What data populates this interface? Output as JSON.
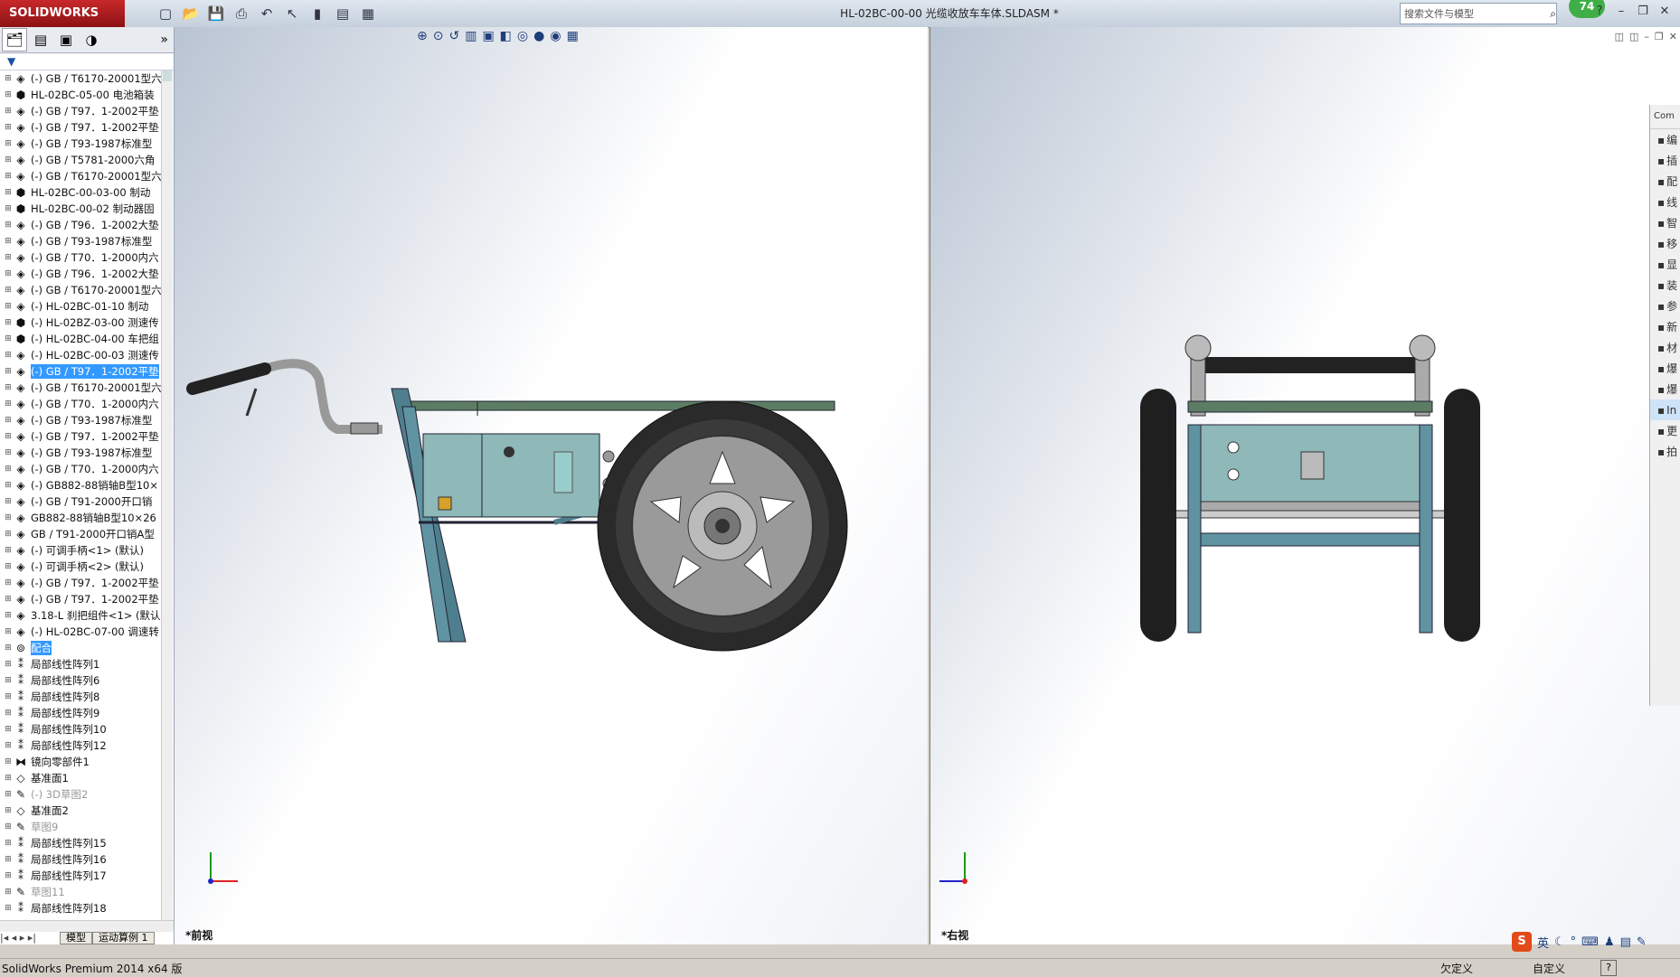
{
  "app": {
    "brand": "SOLIDWORKS",
    "doc_title": "HL-02BC-00-00 光缆收放车车体.SLDASM *",
    "badge": "74"
  },
  "search": {
    "placeholder": "搜索文件与模型"
  },
  "tree": [
    {
      "label": "(-) GB / T6170-20001型六",
      "icon": "part-icon"
    },
    {
      "label": "HL-02BC-05-00 电池箱装",
      "icon": "assembly-icon"
    },
    {
      "label": "(-) GB / T97．1-2002平垫",
      "icon": "part-icon"
    },
    {
      "label": "(-) GB / T97．1-2002平垫",
      "icon": "part-icon"
    },
    {
      "label": "(-) GB / T93-1987标准型",
      "icon": "part-icon"
    },
    {
      "label": "(-) GB / T5781-2000六角",
      "icon": "part-icon"
    },
    {
      "label": "(-) GB / T6170-20001型六",
      "icon": "part-icon"
    },
    {
      "label": "HL-02BC-00-03-00 制动",
      "icon": "assembly-icon"
    },
    {
      "label": "HL-02BC-00-02 制动器固",
      "icon": "assembly-icon"
    },
    {
      "label": "(-) GB / T96．1-2002大垫",
      "icon": "part-icon"
    },
    {
      "label": "(-) GB / T93-1987标准型",
      "icon": "part-icon"
    },
    {
      "label": "(-) GB / T70．1-2000内六",
      "icon": "part-icon"
    },
    {
      "label": "(-) GB / T96．1-2002大垫",
      "icon": "part-icon"
    },
    {
      "label": "(-) GB / T6170-20001型六",
      "icon": "part-icon"
    },
    {
      "label": "(-) HL-02BC-01-10 制动",
      "icon": "part-icon"
    },
    {
      "label": "(-) HL-02BZ-03-00 测速传",
      "icon": "assembly-icon"
    },
    {
      "label": "(-) HL-02BC-04-00 车把组",
      "icon": "assembly-icon"
    },
    {
      "label": "(-) HL-02BC-00-03 测速传",
      "icon": "part-icon"
    },
    {
      "label": "(-) GB / T97．1-2002平垫",
      "icon": "part-icon",
      "selected": true
    },
    {
      "label": "(-) GB / T6170-20001型六",
      "icon": "part-icon"
    },
    {
      "label": "(-) GB / T70．1-2000内六",
      "icon": "part-icon"
    },
    {
      "label": "(-) GB / T93-1987标准型",
      "icon": "part-icon"
    },
    {
      "label": "(-) GB / T97．1-2002平垫",
      "icon": "part-icon"
    },
    {
      "label": "(-) GB / T93-1987标准型",
      "icon": "part-icon"
    },
    {
      "label": "(-) GB / T70．1-2000内六",
      "icon": "part-icon"
    },
    {
      "label": "(-) GB882-88销轴B型10×",
      "icon": "part-icon"
    },
    {
      "label": "(-) GB / T91-2000开口销",
      "icon": "part-icon"
    },
    {
      "label": "GB882-88销轴B型10×26",
      "icon": "part-icon"
    },
    {
      "label": "GB / T91-2000开口销A型",
      "icon": "part-icon"
    },
    {
      "label": "(-) 可调手柄<1> (默认)",
      "icon": "part-icon"
    },
    {
      "label": "(-) 可调手柄<2> (默认)",
      "icon": "part-icon"
    },
    {
      "label": "(-) GB / T97．1-2002平垫",
      "icon": "part-icon"
    },
    {
      "label": "(-) GB / T97．1-2002平垫",
      "icon": "part-icon"
    },
    {
      "label": "3.18-L 刹把组件<1> (默认",
      "icon": "part-icon"
    },
    {
      "label": "(-) HL-02BC-07-00 调速转",
      "icon": "part-icon"
    },
    {
      "label": "配合",
      "icon": "mates-icon",
      "selected": true
    },
    {
      "label": "局部线性阵列1",
      "icon": "pattern-icon"
    },
    {
      "label": "局部线性阵列6",
      "icon": "pattern-icon"
    },
    {
      "label": "局部线性阵列8",
      "icon": "pattern-icon"
    },
    {
      "label": "局部线性阵列9",
      "icon": "pattern-icon"
    },
    {
      "label": "局部线性阵列10",
      "icon": "pattern-icon"
    },
    {
      "label": "局部线性阵列12",
      "icon": "pattern-icon"
    },
    {
      "label": "镜向零部件1",
      "icon": "mirror-icon"
    },
    {
      "label": "基准面1",
      "icon": "plane-icon"
    },
    {
      "label": "(-) 3D草图2",
      "icon": "sketch-icon",
      "gray": true
    },
    {
      "label": "基准面2",
      "icon": "plane-icon"
    },
    {
      "label": "草图9",
      "icon": "sketch-icon",
      "gray": true
    },
    {
      "label": "局部线性阵列15",
      "icon": "pattern-icon"
    },
    {
      "label": "局部线性阵列16",
      "icon": "pattern-icon"
    },
    {
      "label": "局部线性阵列17",
      "icon": "pattern-icon"
    },
    {
      "label": "草图11",
      "icon": "sketch-icon",
      "gray": true
    },
    {
      "label": "局部线性阵列18",
      "icon": "pattern-icon"
    }
  ],
  "bottom_tabs": [
    "模型",
    "运动算例 1"
  ],
  "viewports": {
    "left_label": "*前视",
    "right_label": "*右视"
  },
  "task_panel": {
    "head": "Com",
    "items": [
      "编",
      "插",
      "配",
      "线",
      "智",
      "移",
      "显",
      "装",
      "参",
      "新",
      "材",
      "爆",
      "爆",
      "In",
      "更",
      "拍"
    ]
  },
  "status": {
    "left": "SolidWorks Premium 2014 x64 版",
    "state": "欠定义",
    "mode": "自定义"
  },
  "ime": {
    "lang": "英"
  },
  "colors": {
    "accent": "#3399ff",
    "brand": "#c8282a",
    "frame": "#4f7f8e",
    "box": "#8fb8b8"
  }
}
